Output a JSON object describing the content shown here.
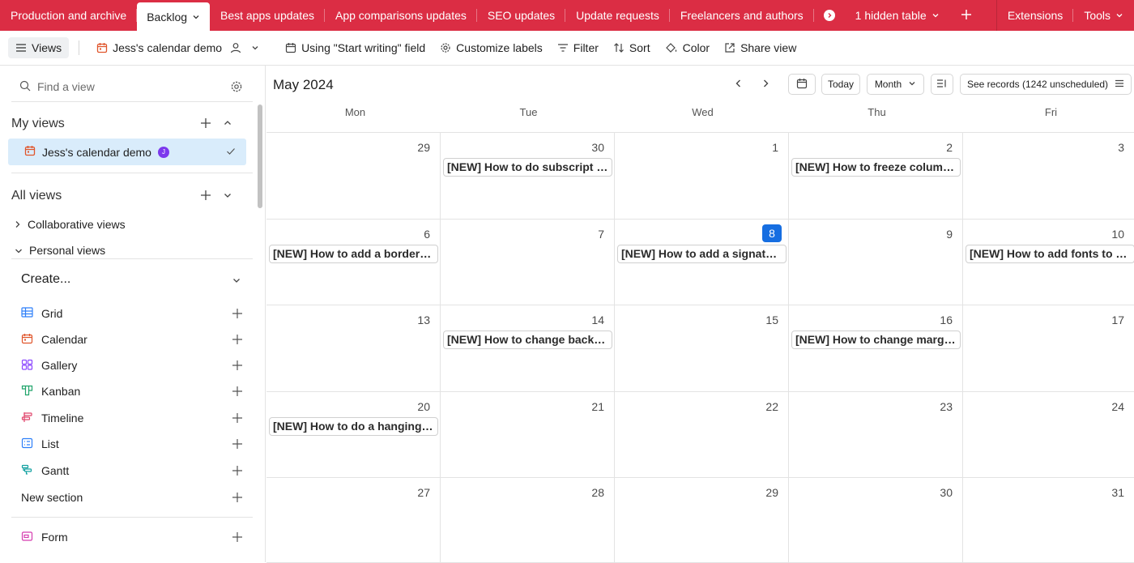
{
  "tabs": {
    "items": [
      {
        "label": "Production and archive"
      },
      {
        "label": "Backlog",
        "active": true
      },
      {
        "label": "Best apps updates"
      },
      {
        "label": "App comparisons updates"
      },
      {
        "label": "SEO updates"
      },
      {
        "label": "Update requests"
      },
      {
        "label": "Freelancers and authors"
      }
    ],
    "hidden_label": "1 hidden table",
    "add_icon": "plus-icon",
    "extensions_label": "Extensions",
    "tools_label": "Tools"
  },
  "toolbar": {
    "views_label": "Views",
    "view_name": "Jess's calendar demo",
    "start_field_label": "Using \"Start writing\" field",
    "customize_label": "Customize labels",
    "filter_label": "Filter",
    "sort_label": "Sort",
    "color_label": "Color",
    "share_label": "Share view"
  },
  "sidebar": {
    "find_placeholder": "Find a view",
    "my_views_title": "My views",
    "my_views": [
      {
        "label": "Jess's calendar demo",
        "avatar": "J"
      }
    ],
    "all_views_title": "All views",
    "collaborative_label": "Collaborative views",
    "personal_label": "Personal views",
    "create_title": "Create...",
    "create_items": [
      {
        "label": "Grid",
        "icon": "grid-icon"
      },
      {
        "label": "Calendar",
        "icon": "calendar-icon"
      },
      {
        "label": "Gallery",
        "icon": "gallery-icon"
      },
      {
        "label": "Kanban",
        "icon": "kanban-icon"
      },
      {
        "label": "Timeline",
        "icon": "timeline-icon"
      },
      {
        "label": "List",
        "icon": "list-icon"
      },
      {
        "label": "Gantt",
        "icon": "gantt-icon"
      },
      {
        "label": "New section",
        "icon": ""
      },
      {
        "label": "Form",
        "icon": "form-icon"
      }
    ]
  },
  "calendar": {
    "title": "May 2024",
    "today_label": "Today",
    "range_label": "Month",
    "see_records_label": "See records (1242 unscheduled)",
    "weekdays": [
      "Mon",
      "Tue",
      "Wed",
      "Thu",
      "Fri"
    ],
    "weeks": [
      [
        {
          "day": "29"
        },
        {
          "day": "30",
          "event": "[NEW] How to do subscript in..."
        },
        {
          "day": "1"
        },
        {
          "day": "2",
          "event": "[NEW] How to freeze column..."
        },
        {
          "day": "3"
        }
      ],
      [
        {
          "day": "6",
          "event": "[NEW] How to add a border i..."
        },
        {
          "day": "7"
        },
        {
          "day": "8",
          "today": true,
          "event": "[NEW] How to add a signatur..."
        },
        {
          "day": "9"
        },
        {
          "day": "10",
          "event": "[NEW] How to add fonts to G..."
        }
      ],
      [
        {
          "day": "13"
        },
        {
          "day": "14",
          "event": "[NEW] How to change backgr..."
        },
        {
          "day": "15"
        },
        {
          "day": "16",
          "event": "[NEW] How to change margin..."
        },
        {
          "day": "17"
        }
      ],
      [
        {
          "day": "20",
          "event": "[NEW] How to do a hanging i..."
        },
        {
          "day": "21"
        },
        {
          "day": "22"
        },
        {
          "day": "23"
        },
        {
          "day": "24"
        }
      ],
      [
        {
          "day": "27"
        },
        {
          "day": "28"
        },
        {
          "day": "29"
        },
        {
          "day": "30"
        },
        {
          "day": "31"
        }
      ]
    ]
  },
  "colors": {
    "brand": "#db2d44",
    "today": "#166ee1",
    "selected_view": "#d9ecfb",
    "avatar": "#7c39ed"
  }
}
